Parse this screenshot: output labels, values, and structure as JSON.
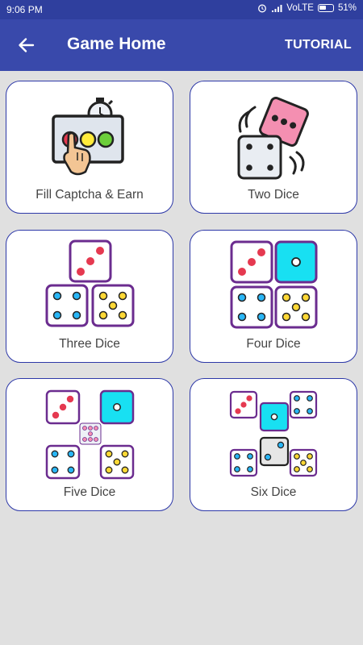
{
  "status_bar": {
    "time": "9:06 PM",
    "network": "VoLTE",
    "battery": "51%"
  },
  "app_bar": {
    "title": "Game Home",
    "back_icon": "arrow-left-icon",
    "action_label": "TUTORIAL"
  },
  "cards": [
    {
      "label": "Fill Captcha & Earn",
      "icon": "captcha-touch-icon"
    },
    {
      "label": "Two Dice",
      "icon": "two-dice-icon"
    },
    {
      "label": "Three Dice",
      "icon": "three-dice-icon"
    },
    {
      "label": "Four Dice",
      "icon": "four-dice-icon"
    },
    {
      "label": "Five Dice",
      "icon": "five-dice-icon"
    },
    {
      "label": "Six Dice",
      "icon": "six-dice-icon"
    }
  ],
  "colors": {
    "app_bar": "#3949ab",
    "status_bar": "#2f3f9e",
    "card_border": "#2d38a8",
    "background": "#e0e0e0"
  }
}
